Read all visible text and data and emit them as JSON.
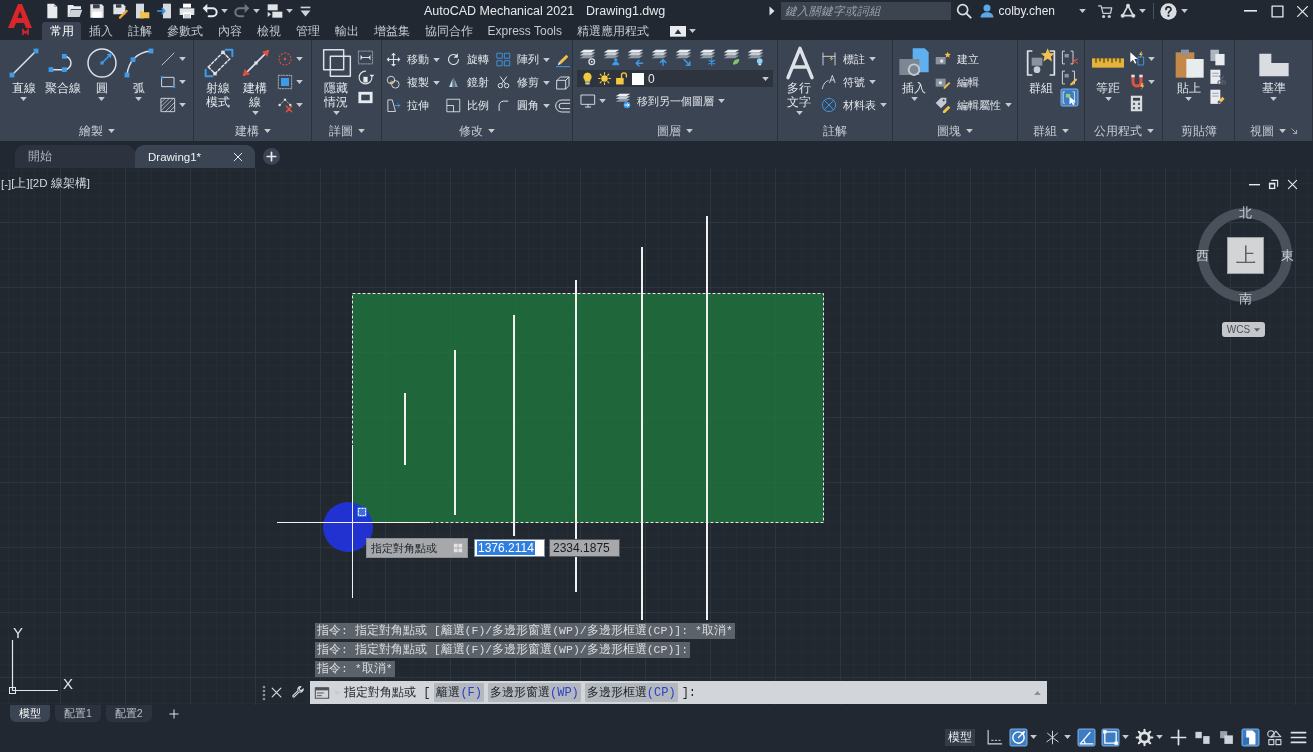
{
  "title_bar": {
    "title": "AutoCAD Mechanical 2021",
    "document": "Drawing1.dwg",
    "search": {
      "placeholder": "鍵入關鍵字或詞組"
    },
    "user": "colby.chen"
  },
  "quick_access_toolbar": {
    "undo_disabled": false,
    "redo_disabled": true
  },
  "ribbon_tabs": [
    {
      "label": "常用",
      "selected": true
    },
    {
      "label": "插入",
      "selected": false
    },
    {
      "label": "註解",
      "selected": false
    },
    {
      "label": "參數式",
      "selected": false
    },
    {
      "label": "內容",
      "selected": false
    },
    {
      "label": "檢視",
      "selected": false
    },
    {
      "label": "管理",
      "selected": false
    },
    {
      "label": "輸出",
      "selected": false
    },
    {
      "label": "增益集",
      "selected": false
    },
    {
      "label": "協同合作",
      "selected": false
    },
    {
      "label": "Express Tools",
      "selected": false
    },
    {
      "label": "精選應用程式",
      "selected": false
    }
  ],
  "ribbon_panels": [
    {
      "kind": "tools",
      "title": "繪製",
      "expandable": true,
      "dialog_launcher": false,
      "large": [
        {
          "kind": "one_line",
          "label": "直線",
          "dropdown": true
        },
        {
          "kind": "one_line",
          "label": "聚合線",
          "dropdown": false
        },
        {
          "kind": "one_line",
          "label": "圓",
          "dropdown": true
        },
        {
          "kind": "one_line",
          "label": "弧",
          "dropdown": true
        }
      ],
      "small": [
        {
          "dropdown": true
        },
        {
          "dropdown": true
        },
        {
          "dropdown": true
        }
      ]
    },
    {
      "kind": "tools",
      "title": "建構",
      "expandable": true,
      "dialog_launcher": false,
      "large": [
        {
          "kind": "two_line",
          "label": "射線模式",
          "dropdown": false
        },
        {
          "kind": "two_line",
          "label": "建構線",
          "dropdown": true
        }
      ],
      "small": [
        {
          "dropdown": true
        },
        {
          "dropdown": true
        },
        {
          "dropdown": true
        }
      ]
    },
    {
      "kind": "tools",
      "title": "詳圖",
      "expandable": true,
      "dialog_launcher": false,
      "large": [
        {
          "kind": "two_line",
          "label": "隱藏情況",
          "dropdown": true
        }
      ],
      "small": [
        {
          "dropdown": false
        },
        {
          "dropdown": false
        },
        {
          "dropdown": false
        }
      ]
    },
    {
      "kind": "grid",
      "title": "修改",
      "expandable": true,
      "dialog_launcher": false,
      "small": [
        {
          "label": "移動",
          "dropdown": true
        },
        {
          "label": "旋轉",
          "dropdown": false
        },
        {
          "label": "陣列",
          "dropdown": true
        },
        {
          "dropdown": false
        },
        {
          "label": "複製",
          "dropdown": true
        },
        {
          "label": "鏡射",
          "dropdown": false
        },
        {
          "label": "修剪",
          "dropdown": true
        },
        {
          "dropdown": false
        },
        {
          "label": "拉伸",
          "dropdown": false
        },
        {
          "label": "比例",
          "dropdown": false
        },
        {
          "label": "圓角",
          "dropdown": true
        },
        {
          "dropdown": false
        }
      ]
    },
    {
      "kind": "layers",
      "title": "圖層",
      "expandable": true,
      "dialog_launcher": false,
      "small": [
        {
          "dropdown": false
        },
        {
          "dropdown": false
        },
        {
          "dropdown": false
        },
        {
          "dropdown": false
        },
        {
          "dropdown": false
        },
        {
          "dropdown": false
        },
        {
          "dropdown": false
        },
        {
          "dropdown": false
        }
      ],
      "layer": {
        "value": "0",
        "color": "#ffffff"
      },
      "actions": [
        {
          "dropdown": true
        },
        {
          "label": "移到另一個圖層",
          "dropdown": true
        }
      ]
    },
    {
      "kind": "tools",
      "title": "註解",
      "expandable": false,
      "dialog_launcher": false,
      "large": [
        {
          "kind": "two_line",
          "label": "多行文字",
          "dropdown": true
        }
      ],
      "small": [
        {
          "label": "標註",
          "dropdown": true
        },
        {
          "label": "符號",
          "dropdown": true
        },
        {
          "label": "材料表",
          "dropdown": true
        }
      ]
    },
    {
      "kind": "tools",
      "title": "圖塊",
      "expandable": true,
      "dialog_launcher": false,
      "large": [
        {
          "kind": "one_line",
          "label": "插入",
          "dropdown": true
        }
      ],
      "small": [
        {
          "label": "建立",
          "dropdown": false
        },
        {
          "label": "編輯",
          "dropdown": false
        },
        {
          "label": "編輯屬性",
          "dropdown": true
        }
      ]
    },
    {
      "kind": "tools",
      "title": "群組",
      "expandable": true,
      "dialog_launcher": false,
      "large": [
        {
          "kind": "one_line",
          "label": "群組",
          "dropdown": false
        }
      ],
      "small": [
        {
          "dropdown": false,
          "on": false
        },
        {
          "dropdown": false,
          "on": false
        },
        {
          "dropdown": false,
          "on": true
        }
      ]
    },
    {
      "kind": "tools",
      "title": "公用程式",
      "expandable": true,
      "dialog_launcher": false,
      "large": [
        {
          "kind": "one_line",
          "label": "等距",
          "dropdown": true
        }
      ],
      "small": [
        {
          "dropdown": true
        },
        {
          "dropdown": true
        },
        {
          "dropdown": false
        }
      ]
    },
    {
      "kind": "tools",
      "title": "剪貼簿",
      "expandable": false,
      "dialog_launcher": false,
      "large": [
        {
          "kind": "one_line",
          "label": "貼上",
          "dropdown": true
        }
      ],
      "small": [
        {
          "dropdown": false
        },
        {
          "dropdown": false
        },
        {
          "dropdown": false
        }
      ]
    },
    {
      "kind": "tools",
      "title": "視圖",
      "expandable": true,
      "dialog_launcher": true,
      "large": [
        {
          "kind": "one_line",
          "label": "基準",
          "dropdown": true
        }
      ]
    }
  ],
  "file_tabs": [
    {
      "label": "開始",
      "selected": false
    },
    {
      "label": "Drawing1*",
      "selected": true
    }
  ],
  "viewport_controls": [
    "[-]",
    "[上]",
    "[2D 線架構]"
  ],
  "viewcube": {
    "north": "北",
    "east": "東",
    "south": "南",
    "west": "西",
    "face": "上",
    "coordinate_system": "WCS"
  },
  "ucs": {
    "x_label": "X",
    "y_label": "Y"
  },
  "dynamic_input": {
    "prompt": "指定對角點或",
    "fields": [
      {
        "value": "1376.2114",
        "selected": true
      },
      {
        "value": "2334.1875",
        "selected": false
      }
    ]
  },
  "command_history": [
    "指令: 指定對角點或 [籬選(F)/多邊形窗選(WP)/多邊形框選(CP)]: *取消*",
    "指令: 指定對角點或 [籬選(F)/多邊形窗選(WP)/多邊形框選(CP)]:",
    "指令: *取消*"
  ],
  "command_line": {
    "prompt": "指定對角點或 [",
    "options": [
      {
        "label": "籬選",
        "key": "(F)"
      },
      {
        "label": "多邊形窗選",
        "key": "(WP)"
      },
      {
        "label": "多邊形框選",
        "key": "(CP)"
      }
    ],
    "suffix": "]:"
  },
  "layout_tabs": [
    {
      "label": "模型",
      "selected": true
    },
    {
      "label": "配置1",
      "selected": false
    },
    {
      "label": "配置2",
      "selected": false
    }
  ],
  "status_bar": {
    "space": "模型",
    "toggles": [
      {
        "on": false,
        "dropdown": false
      },
      {
        "on": true,
        "dropdown": true
      },
      {
        "on": false,
        "dropdown": true
      },
      {
        "on": true,
        "dropdown": false
      },
      {
        "on": true,
        "dropdown": true
      },
      {
        "on": false,
        "dropdown": true
      },
      {
        "on": false,
        "dropdown": false
      },
      {
        "on": false,
        "dropdown": false
      },
      {
        "on": false,
        "dropdown": false
      },
      {
        "on": true,
        "dropdown": false
      },
      {
        "on": false,
        "dropdown": false
      },
      {
        "on": false,
        "dropdown": false
      }
    ]
  }
}
